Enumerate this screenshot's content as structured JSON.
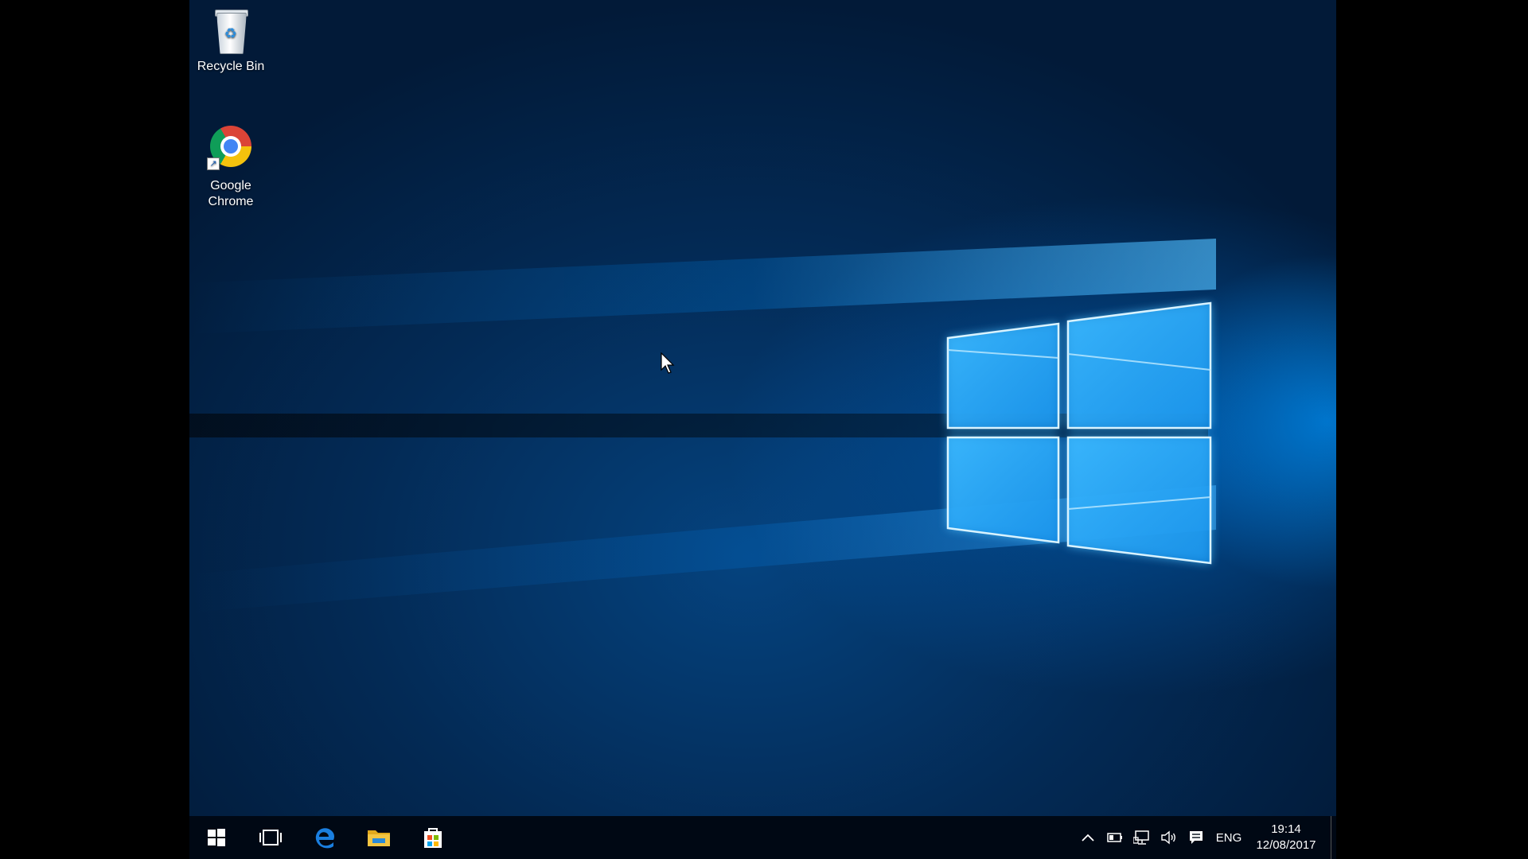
{
  "desktop": {
    "icons": [
      {
        "label": "Recycle Bin",
        "icon": "recycle-bin-icon"
      },
      {
        "label": "Google\nChrome",
        "icon": "chrome-icon",
        "shortcut": true
      }
    ]
  },
  "taskbar": {
    "pinned": [
      {
        "name": "start",
        "icon": "windows-icon"
      },
      {
        "name": "task-view",
        "icon": "task-view-icon"
      },
      {
        "name": "edge",
        "icon": "edge-icon"
      },
      {
        "name": "file-explorer",
        "icon": "folder-icon"
      },
      {
        "name": "store",
        "icon": "store-icon"
      }
    ],
    "tray": {
      "language": "ENG",
      "time": "19:14",
      "date": "12/08/2017"
    }
  },
  "colors": {
    "taskbar_bg": "#000814",
    "edge_blue": "#1a7fe0",
    "folder_yellow": "#f4c542",
    "accent_glow": "#5fc6ff"
  }
}
